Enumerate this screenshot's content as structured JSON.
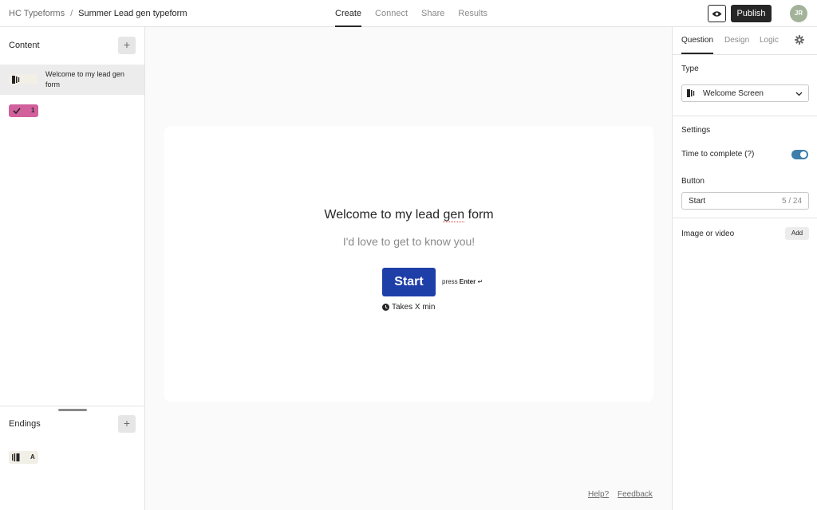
{
  "breadcrumb": {
    "workspace": "HC Typeforms",
    "separator": "/",
    "form_name": "Summer Lead gen typeform"
  },
  "nav_tabs": [
    {
      "label": "Create",
      "active": true
    },
    {
      "label": "Connect",
      "active": false
    },
    {
      "label": "Share",
      "active": false
    },
    {
      "label": "Results",
      "active": false
    }
  ],
  "header": {
    "preview_icon": "eye-icon",
    "publish_label": "Publish",
    "avatar_initials": "JR",
    "avatar_color": "#a3b39a"
  },
  "sidebar": {
    "content_title": "Content",
    "add_label": "+",
    "items": [
      {
        "kind": "welcome",
        "label": "Welcome to my lead gen form",
        "icon": "welcome-screen-icon"
      },
      {
        "kind": "question",
        "number": "1",
        "icon": "checkmark-icon",
        "color": "#d1609c"
      }
    ],
    "endings_title": "Endings",
    "endings": [
      {
        "letter": "A",
        "icon": "ending-screen-icon"
      }
    ]
  },
  "welcome": {
    "title_pre": "Welcome to my lead ",
    "title_misspelled": "gen",
    "title_post": " form",
    "description": "I'd love to get to know you!",
    "button_label": "Start",
    "press_prefix": "press",
    "press_key": "Enter",
    "press_symbol": "↵",
    "time_text": "Takes X min",
    "button_color": "#1e3ea8"
  },
  "footer": {
    "help": "Help?",
    "feedback": "Feedback"
  },
  "panel": {
    "tabs": [
      {
        "label": "Question",
        "active": true
      },
      {
        "label": "Design",
        "active": false
      },
      {
        "label": "Logic",
        "active": false
      }
    ],
    "type_label": "Type",
    "type_value": "Welcome Screen",
    "settings_label": "Settings",
    "time_to_complete_label": "Time to complete (?)",
    "time_to_complete_on": true,
    "button_label": "Button",
    "button_value": "Start",
    "button_count": "5 / 24",
    "image_label": "Image or video",
    "image_add": "Add",
    "toggle_color": "#3d7eaa"
  }
}
